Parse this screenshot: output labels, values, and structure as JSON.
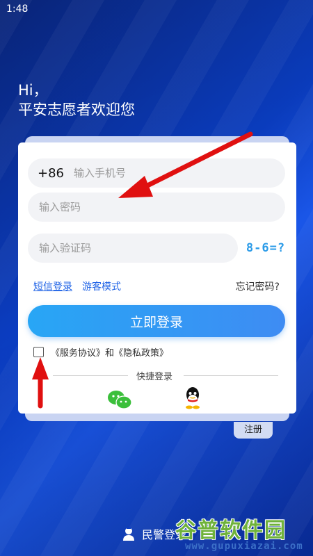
{
  "status_bar": {
    "time": "1:48"
  },
  "greeting": {
    "line1": "Hi，",
    "line2": "平安志愿者欢迎您"
  },
  "form": {
    "phone": {
      "country_code": "+86",
      "placeholder": "输入手机号"
    },
    "password": {
      "placeholder": "输入密码"
    },
    "verify": {
      "placeholder": "输入验证码"
    },
    "captcha": {
      "text": "8-6=?"
    },
    "sms_login": "短信登录",
    "guest_mode": "游客模式",
    "forgot_password": "忘记密码?",
    "login_button": "立即登录",
    "agreement": {
      "service": "《服务协议》",
      "and": "和",
      "privacy": "《隐私政策》"
    },
    "quick_login_title": "快捷登录",
    "quick_login_icons": [
      "wechat-icon",
      "qq-icon"
    ]
  },
  "register_tab": "注册",
  "police_login": {
    "label": "民警登录",
    "icon": "police-icon"
  },
  "watermark": {
    "title": "谷普软件园",
    "url": "www.gupuxiazai.com"
  },
  "colors": {
    "accent_blue": "#1e62e6",
    "button_gradient_start": "#28a6f5",
    "button_gradient_end": "#3e8cf3",
    "arrow_red": "#e01010",
    "background": "#0b3fc7"
  }
}
